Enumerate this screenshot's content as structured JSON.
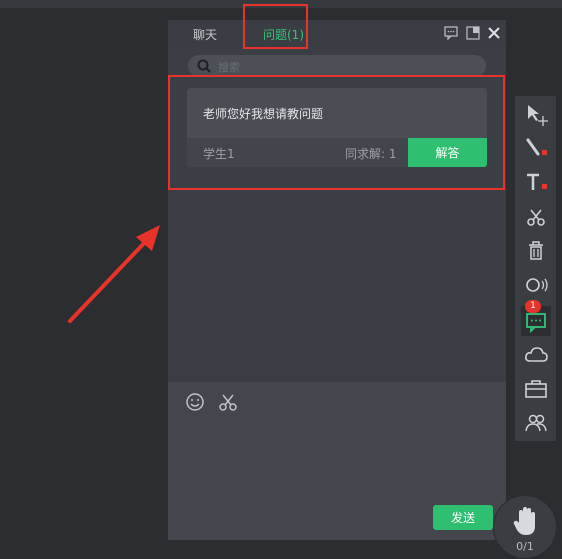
{
  "tabs": [
    {
      "label": "聊天",
      "active": false
    },
    {
      "label": "问题(1)",
      "active": true
    }
  ],
  "search": {
    "placeholder": "搜索"
  },
  "question": {
    "text": "老师您好我想请教问题",
    "student": "学生1",
    "seek_count": "同求解: 1",
    "answer_label": "解答"
  },
  "composer": {
    "send_label": "发送"
  },
  "toolbar": {
    "chat_badge": "1"
  },
  "hand": {
    "count": "0/1"
  },
  "colors": {
    "accent": "#2fbf71",
    "highlight": "#e8332a",
    "panel": "#3b3e44"
  }
}
